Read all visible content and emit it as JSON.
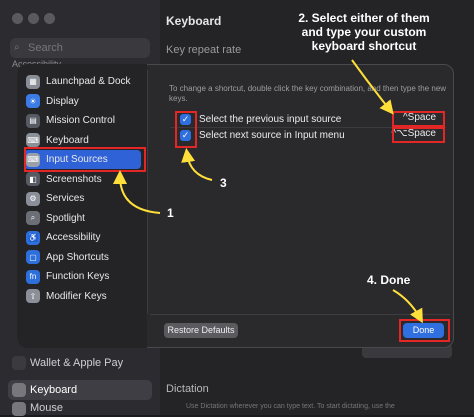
{
  "background": {
    "search_placeholder": "Search",
    "sidebar_top_item": "Accessibility",
    "sidebar_bottom_items": [
      "Wallet & Apple Pay",
      "Keyboard",
      "Mouse"
    ],
    "main_title": "Keyboard",
    "key_repeat_label": "Key repeat rate",
    "dictation_label": "Dictation",
    "dictation_footer": "Use Dictation wherever you can type text. To start dictating, use the"
  },
  "sheet": {
    "categories": [
      {
        "label": "Launchpad & Dock",
        "icon": "launchpad-icon",
        "color": "#888d96"
      },
      {
        "label": "Display",
        "icon": "display-icon",
        "color": "#3b7be5"
      },
      {
        "label": "Mission Control",
        "icon": "mission-control-icon",
        "color": "#555a63"
      },
      {
        "label": "Keyboard",
        "icon": "keyboard-icon",
        "color": "#8a8f98"
      },
      {
        "label": "Input Sources",
        "icon": "input-sources-icon",
        "color": "#9aa0aa"
      },
      {
        "label": "Screenshots",
        "icon": "screenshot-icon",
        "color": "#555a63"
      },
      {
        "label": "Services",
        "icon": "services-icon",
        "color": "#8a8f98"
      },
      {
        "label": "Spotlight",
        "icon": "spotlight-icon",
        "color": "#6c6f76"
      },
      {
        "label": "Accessibility",
        "icon": "accessibility-icon",
        "color": "#2d6fdc"
      },
      {
        "label": "App Shortcuts",
        "icon": "app-shortcuts-icon",
        "color": "#2d6fdc"
      },
      {
        "label": "Function Keys",
        "icon": "function-keys-icon",
        "color": "#2d6fdc"
      },
      {
        "label": "Modifier Keys",
        "icon": "modifier-keys-icon",
        "color": "#8a8f98"
      }
    ],
    "selected_category": "Input Sources",
    "hint": "To change a shortcut, double click the key combination, and then type the new keys.",
    "shortcuts": [
      {
        "label": "Select the previous input source",
        "keys": "^Space",
        "checked": true
      },
      {
        "label": "Select next source in Input menu",
        "keys": "^⌥Space",
        "checked": true
      }
    ],
    "restore_button": "Restore Defaults",
    "done_button": "Done"
  },
  "annotations": {
    "step2": "2. Select either of them and type your custom keyboard shortcut",
    "step2_lines": [
      "2. Select either of them",
      "and type your custom",
      "keyboard shortcut"
    ],
    "step1": "1",
    "step3": "3",
    "step4": "4. Done",
    "accent_color": "#ffe03b",
    "box_color": "#e32727"
  }
}
